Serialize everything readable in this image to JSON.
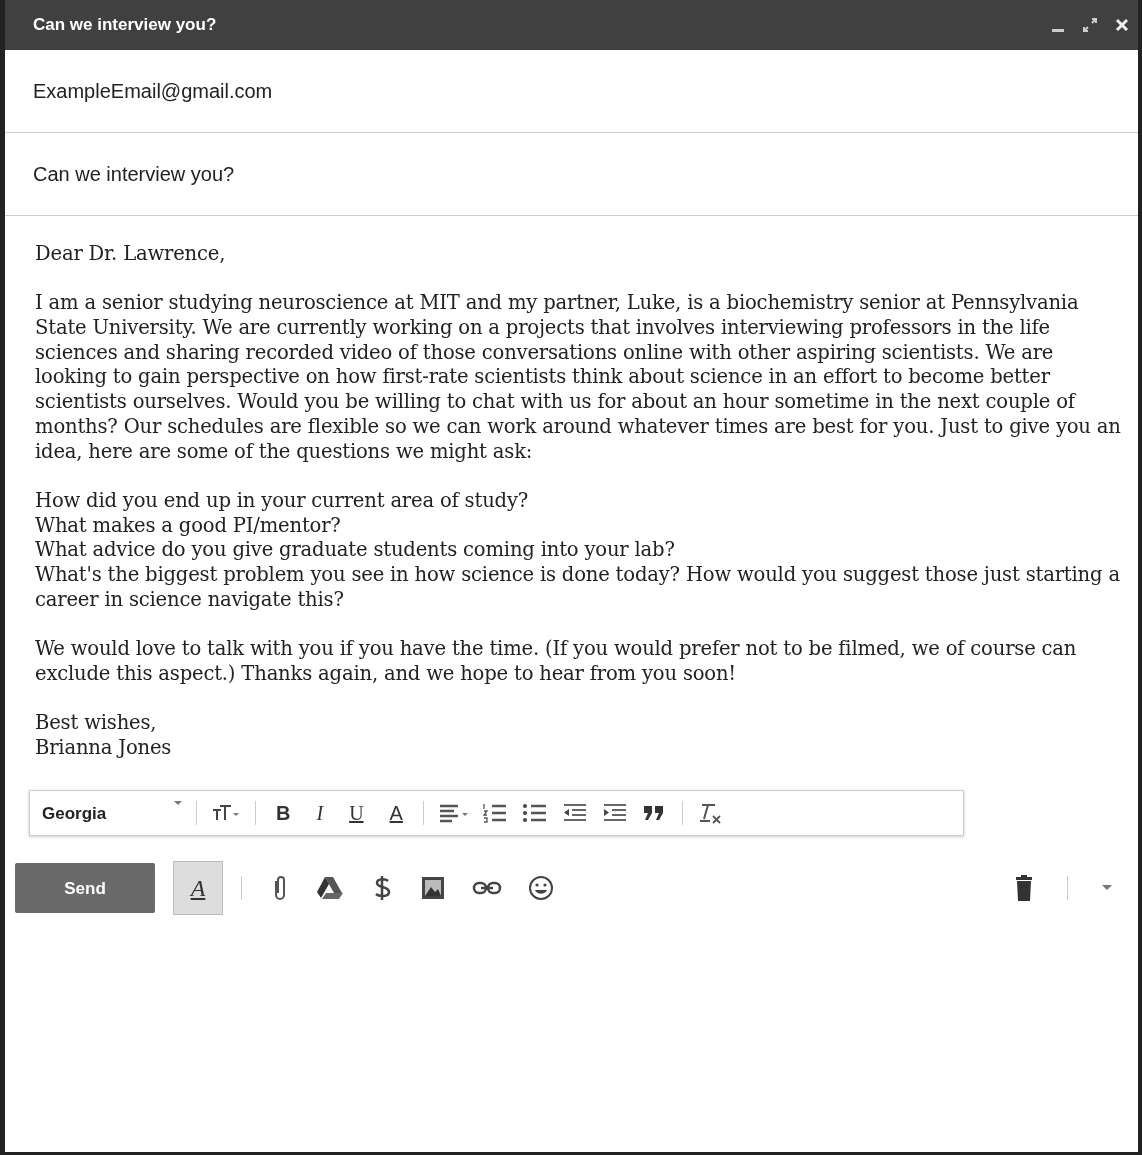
{
  "window": {
    "title": "Can we interview you?"
  },
  "to": {
    "value": "ExampleEmail@gmail.com"
  },
  "subject": {
    "value": "Can we interview you?"
  },
  "body": [
    {
      "kind": "line",
      "text": "Dear Dr. Lawrence,"
    },
    {
      "kind": "gap"
    },
    {
      "kind": "line",
      "text": "I am a senior studying neuroscience at MIT and my partner, Luke, is a biochemistry senior at Pennsylvania State University. We are currently working on a projects that involves interviewing professors in the life sciences and sharing recorded video of those conversations online with other aspiring scientists. We are looking to gain perspective on how first-rate scientists think about science in an effort to become better scientists ourselves. Would you be willing to chat with us for about an hour sometime in the next couple of months? Our schedules are flexible so we can work around whatever times are best for you. Just to give you an idea, here are some of the questions we might ask:"
    },
    {
      "kind": "gap"
    },
    {
      "kind": "line",
      "text": "How did you end up in your current area of study?"
    },
    {
      "kind": "line",
      "text": "What makes a good PI/mentor?"
    },
    {
      "kind": "line",
      "text": "What advice do you give graduate students coming into your lab?"
    },
    {
      "kind": "line",
      "text": "What's the biggest problem you see in how science is done today? How would you suggest those just starting a career in science navigate this?"
    },
    {
      "kind": "gap"
    },
    {
      "kind": "line",
      "text": "We would love to talk with you if you have the time. (If you would prefer not to be filmed, we of course can exclude this aspect.) Thanks again, and we hope to hear from you soon!"
    },
    {
      "kind": "gap"
    },
    {
      "kind": "line",
      "text": "Best wishes,"
    },
    {
      "kind": "line",
      "text": "Brianna Jones"
    }
  ],
  "format_toolbar": [
    {
      "kind": "font",
      "text": "Georgia"
    },
    {
      "kind": "divider"
    },
    {
      "kind": "size"
    },
    {
      "kind": "divider"
    },
    {
      "kind": "bold",
      "text": "B"
    },
    {
      "kind": "italic",
      "text": "I"
    },
    {
      "kind": "underline",
      "text": "U"
    },
    {
      "kind": "color",
      "text": "A"
    },
    {
      "kind": "divider"
    },
    {
      "kind": "align"
    },
    {
      "kind": "numbered"
    },
    {
      "kind": "bulleted"
    },
    {
      "kind": "outdent"
    },
    {
      "kind": "indent"
    },
    {
      "kind": "quote"
    },
    {
      "kind": "divider"
    },
    {
      "kind": "clear"
    }
  ],
  "bottom_bar": {
    "send": "Send",
    "formatting": {
      "text": "A",
      "selected": true
    },
    "tools": [
      {
        "kind": "attach"
      },
      {
        "kind": "drive"
      },
      {
        "kind": "money"
      },
      {
        "kind": "photo"
      },
      {
        "kind": "link"
      },
      {
        "kind": "emoji"
      }
    ]
  }
}
